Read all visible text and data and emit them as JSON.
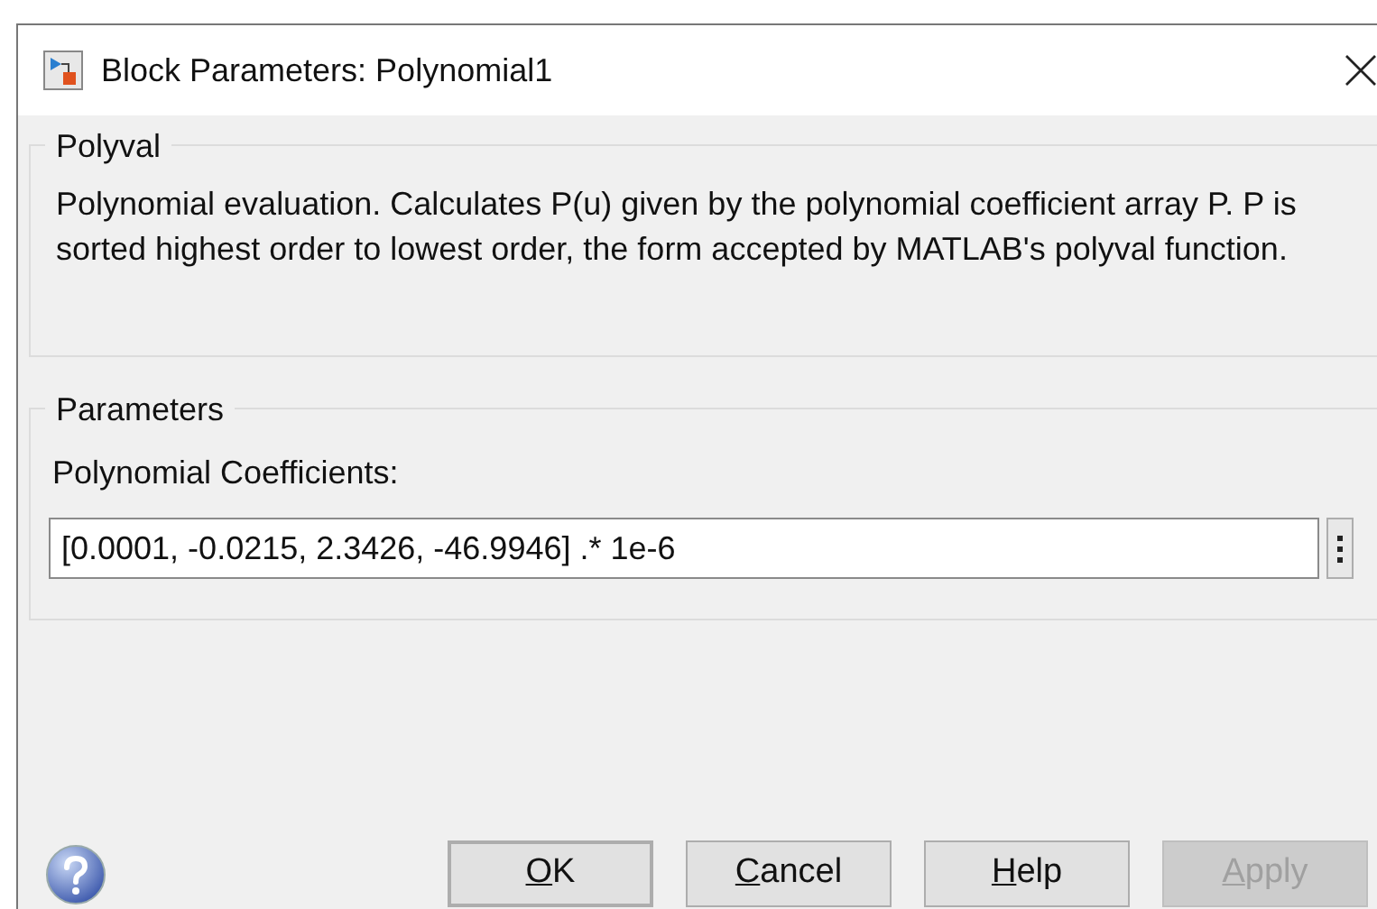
{
  "window": {
    "title": "Block Parameters: Polynomial1"
  },
  "description_group": {
    "title": "Polyval",
    "text": "Polynomial evaluation.  Calculates P(u) given by the polynomial coefficient array P. P is sorted highest order to lowest order, the form accepted by MATLAB's polyval function."
  },
  "parameters_group": {
    "title": "Parameters",
    "field_label": "Polynomial Coefficients:",
    "field_value": "[0.0001, -0.0215, 2.3426, -46.9946] .* 1e-6"
  },
  "buttons": [
    {
      "label": "OK",
      "default": true,
      "disabled": false,
      "underline_first": true
    },
    {
      "label": "Cancel",
      "default": false,
      "disabled": false,
      "underline_first": true
    },
    {
      "label": "Help",
      "default": false,
      "disabled": false,
      "underline_first": true
    },
    {
      "label": "Apply",
      "default": false,
      "disabled": true,
      "underline_first": true
    }
  ]
}
